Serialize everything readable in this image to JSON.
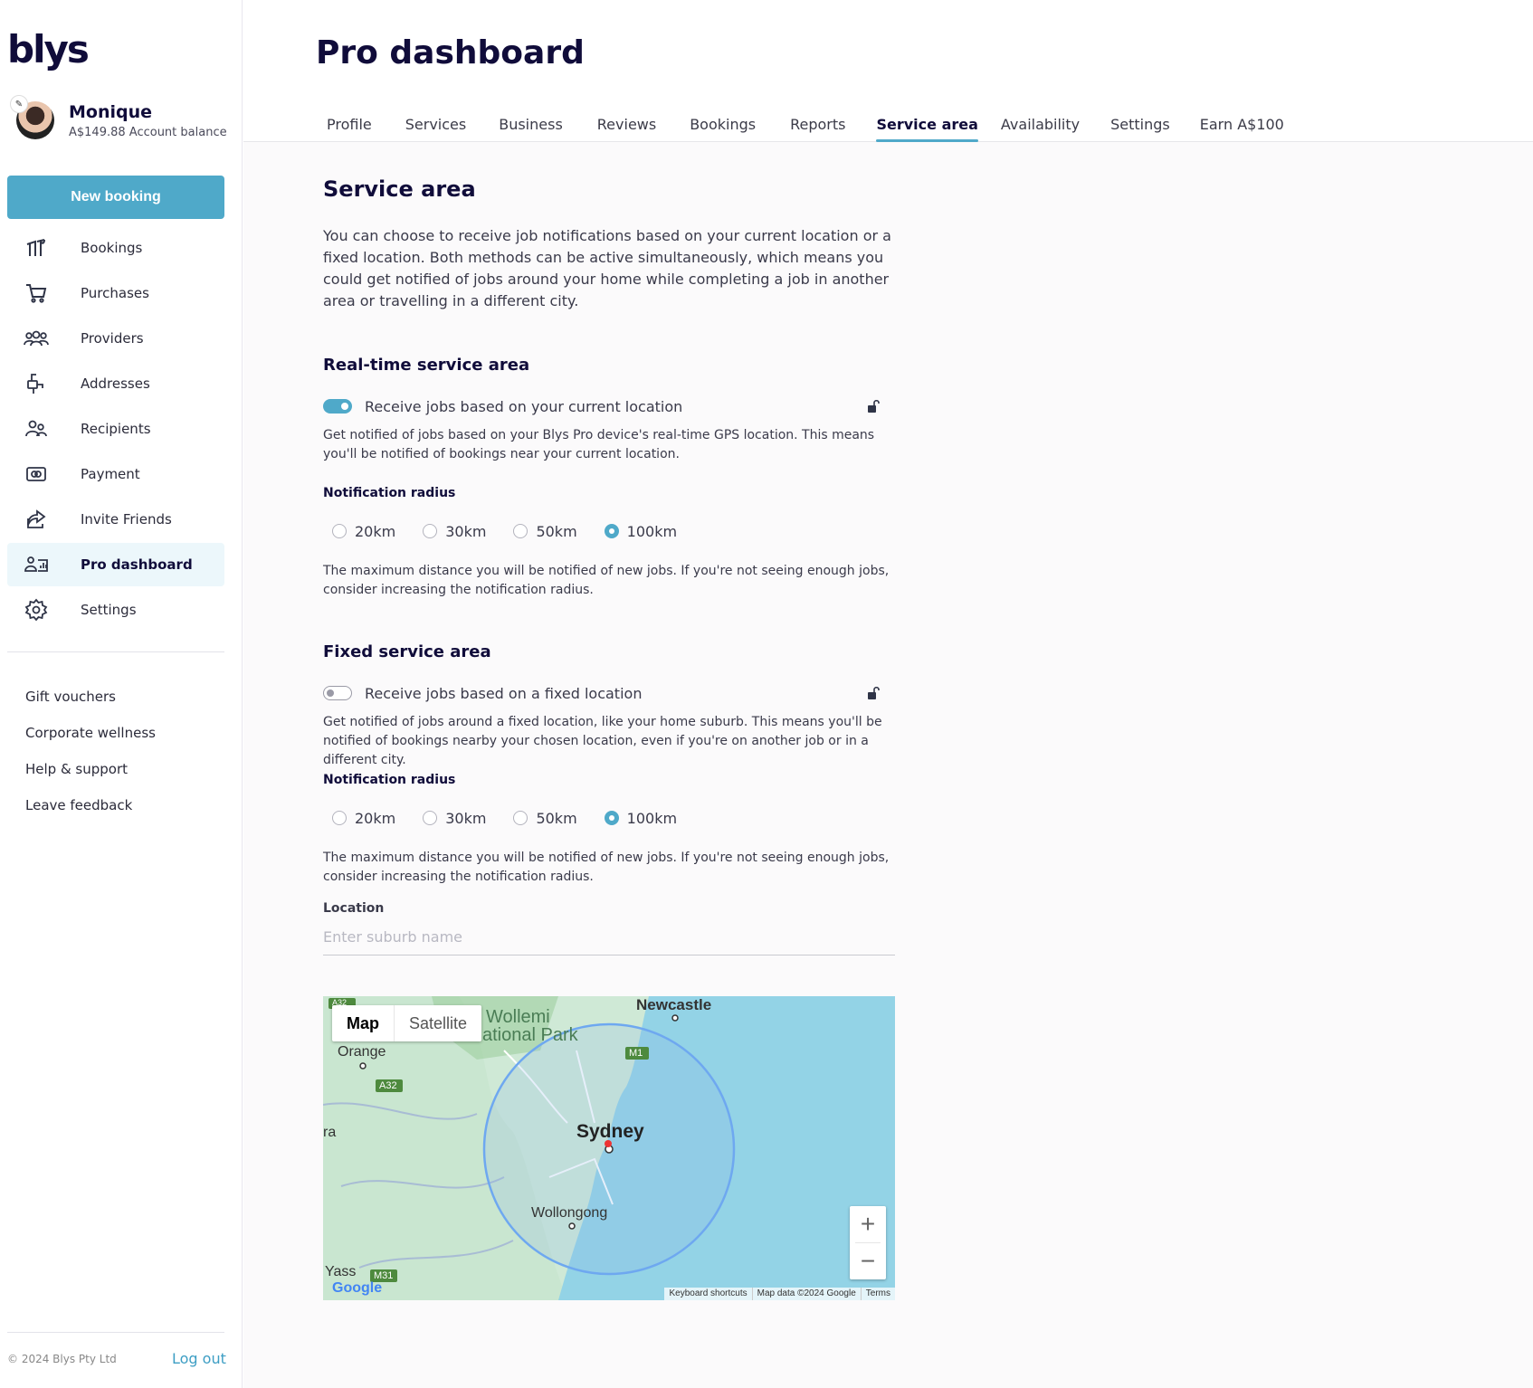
{
  "brand": {
    "logo": "blys"
  },
  "user": {
    "name": "Monique",
    "balance": "A$149.88 Account balance"
  },
  "sidebar": {
    "new_booking": "New booking",
    "items": [
      {
        "label": "Bookings",
        "icon": "bookings-icon"
      },
      {
        "label": "Purchases",
        "icon": "cart-icon"
      },
      {
        "label": "Providers",
        "icon": "providers-icon"
      },
      {
        "label": "Addresses",
        "icon": "address-icon"
      },
      {
        "label": "Recipients",
        "icon": "recipients-icon"
      },
      {
        "label": "Payment",
        "icon": "payment-icon"
      },
      {
        "label": "Invite Friends",
        "icon": "share-icon"
      },
      {
        "label": "Pro dashboard",
        "icon": "pro-dashboard-icon",
        "active": true
      },
      {
        "label": "Settings",
        "icon": "gear-icon"
      }
    ],
    "links": [
      "Gift vouchers",
      "Corporate wellness",
      "Help & support",
      "Leave feedback"
    ],
    "copyright": "© 2024 Blys Pty Ltd",
    "logout": "Log out"
  },
  "header": {
    "title": "Pro dashboard",
    "tabs": [
      "Profile",
      "Services",
      "Business",
      "Reviews",
      "Bookings",
      "Reports",
      "Service area",
      "Availability",
      "Settings",
      "Earn A$100"
    ],
    "active_tab": "Service area"
  },
  "service_area": {
    "title": "Service area",
    "intro": "You can choose to receive job notifications based on your current location or a fixed location. Both methods can be active simultaneously, which means you could get notified of jobs around your home while completing a job in another area or travelling in a different city.",
    "realtime": {
      "title": "Real-time service area",
      "toggle_label": "Receive jobs based on your current location",
      "enabled": true,
      "help": "Get notified of jobs based on your Blys Pro device's real-time GPS location. This means you'll be notified of bookings near your current location.",
      "radius_label": "Notification radius",
      "radius_options": [
        "20km",
        "30km",
        "50km",
        "100km"
      ],
      "radius_selected": "100km",
      "radius_help": "The maximum distance you will be notified of new jobs. If you're not seeing enough jobs, consider increasing the notification radius."
    },
    "fixed": {
      "title": "Fixed service area",
      "toggle_label": "Receive jobs based on a fixed location",
      "enabled": false,
      "help": "Get notified of jobs around a fixed location, like your home suburb. This means you'll be notified of bookings nearby your chosen location, even if you're on another job or in a different city.",
      "radius_label": "Notification radius",
      "radius_options": [
        "20km",
        "30km",
        "50km",
        "100km"
      ],
      "radius_selected": "100km",
      "radius_help": "The maximum distance you will be notified of new jobs. If you're not seeing enough jobs, consider increasing the notification radius.",
      "location_label": "Location",
      "location_placeholder": "Enter suburb name",
      "location_value": ""
    },
    "map": {
      "type_options": [
        "Map",
        "Satellite"
      ],
      "type_selected": "Map",
      "places": [
        "Newcastle",
        "Wollemi",
        "ational Park",
        "Orange",
        "Sydney",
        "Wollongong",
        "Yass",
        "ra"
      ],
      "road_badges": [
        "A32",
        "A32",
        "M1",
        "M31"
      ],
      "zoom_in": "+",
      "zoom_out": "−",
      "footer": [
        "Keyboard shortcuts",
        "Map data ©2024 Google",
        "Terms"
      ],
      "attribution": "Google",
      "colors": {
        "water": "#93d3e6",
        "land": "#cfe9d6",
        "circle": "#6ea8f0"
      }
    }
  }
}
